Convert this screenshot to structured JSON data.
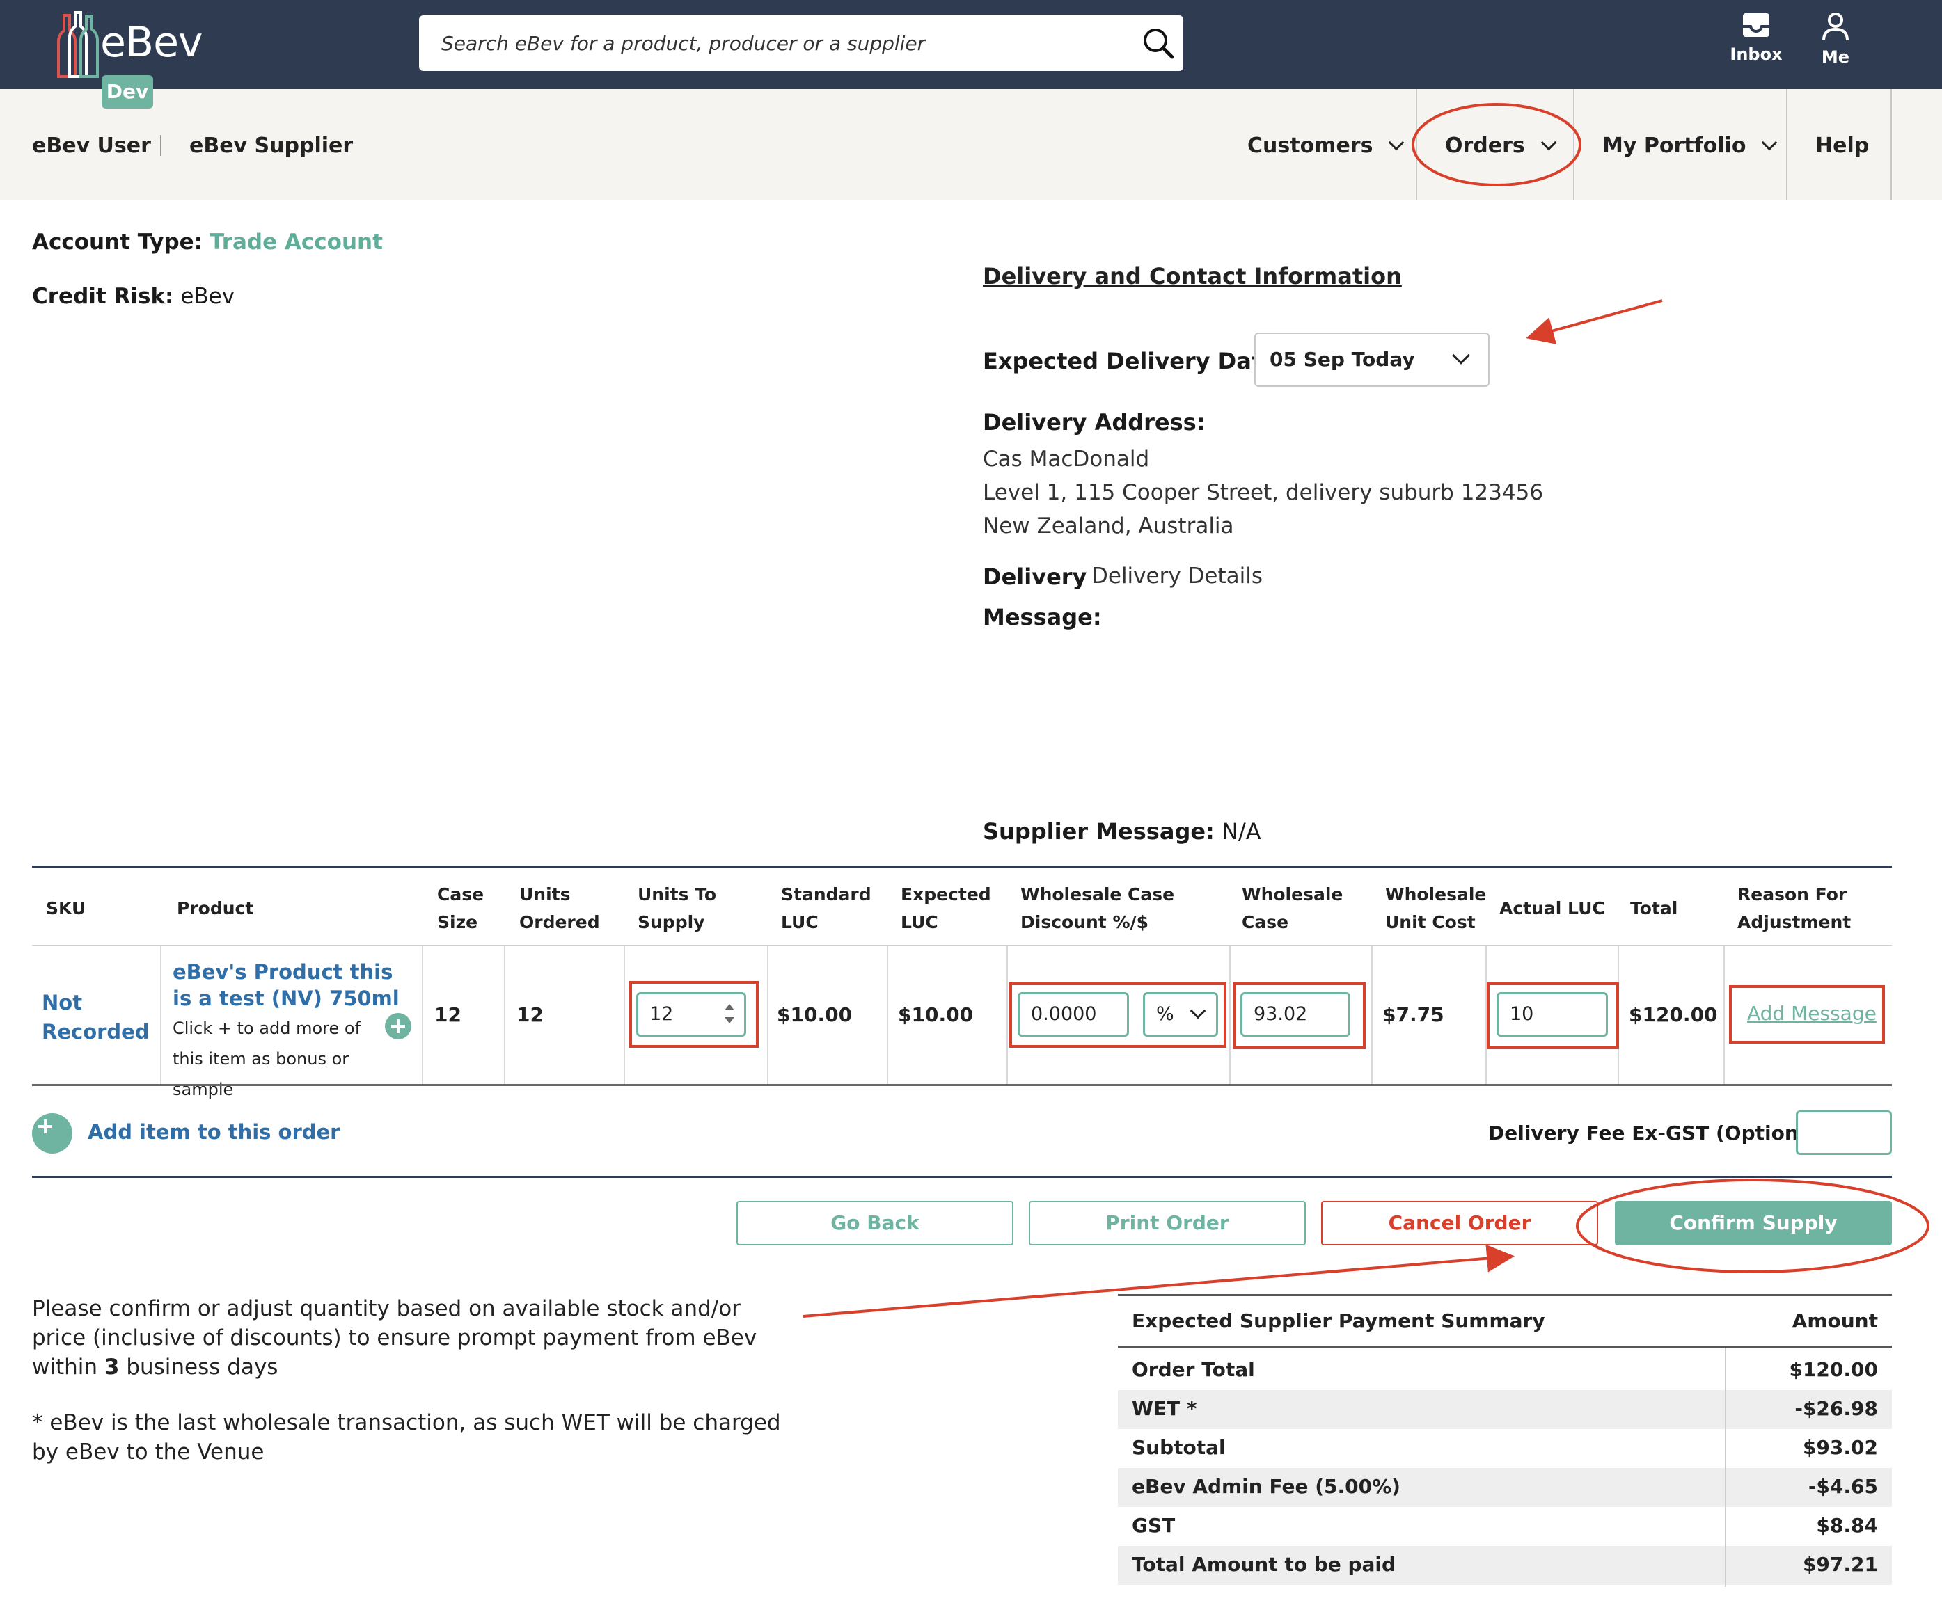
{
  "header": {
    "brand": "eBev",
    "env_badge": "Dev",
    "search_placeholder": "Search eBev for a product, producer or a supplier",
    "inbox_label": "Inbox",
    "me_label": "Me"
  },
  "nav": {
    "user": "eBev User",
    "supplier": "eBev Supplier",
    "items": [
      {
        "label": "Customers"
      },
      {
        "label": "Orders"
      },
      {
        "label": "My Portfolio"
      },
      {
        "label": "Help"
      }
    ]
  },
  "account": {
    "type_label": "Account Type:",
    "type_value": "Trade Account",
    "risk_label": "Credit Risk:",
    "risk_value": "eBev"
  },
  "delivery": {
    "section_title": "Delivery and Contact Information",
    "expected_date_label": "Expected Delivery Date:",
    "expected_date_value": "05 Sep Today",
    "address_label": "Delivery Address:",
    "address_lines": [
      "Cas MacDonald",
      "Level 1, 115 Cooper Street, delivery suburb 123456",
      "New Zealand, Australia"
    ],
    "message_label_1": "Delivery",
    "message_label_2": "Message:",
    "message_value": "Delivery Details",
    "supplier_message_label": "Supplier Message:",
    "supplier_message_value": "N/A"
  },
  "table": {
    "headers": [
      "SKU",
      "Product",
      "Case Size",
      "Units Ordered",
      "Units To Supply",
      "Standard LUC",
      "Expected LUC",
      "Wholesale Case Discount %/$",
      "Wholesale Case",
      "Wholesale Unit Cost",
      "Actual LUC",
      "Total",
      "Reason For Adjustment"
    ],
    "headers_lines": [
      [
        "SKU"
      ],
      [
        "Product"
      ],
      [
        "Case",
        "Size"
      ],
      [
        "Units",
        "Ordered"
      ],
      [
        "Units To",
        "Supply"
      ],
      [
        "Standard",
        "LUC"
      ],
      [
        "Expected",
        "LUC"
      ],
      [
        "Wholesale Case",
        "Discount %/$"
      ],
      [
        "Wholesale",
        "Case"
      ],
      [
        "Wholesale",
        "Unit Cost"
      ],
      [
        "Actual LUC"
      ],
      [
        "Total"
      ],
      [
        "Reason For",
        "Adjustment"
      ]
    ],
    "row": {
      "sku": "Not Recorded",
      "product_name": "eBev's Product this is a test (NV) 750ml",
      "product_hint": "Click + to add more of this item as bonus or sample",
      "case_size": "12",
      "units_ordered": "12",
      "units_to_supply": "12",
      "standard_luc": "$10.00",
      "expected_luc": "$10.00",
      "discount_value": "0.0000",
      "discount_type": "%",
      "wholesale_case": "93.02",
      "wholesale_unit_cost": "$7.75",
      "actual_luc": "10",
      "total": "$120.00",
      "reason_link": "Add Message"
    }
  },
  "actions": {
    "add_item": "Add item to this order",
    "delivery_fee_label": "Delivery Fee Ex-GST (Optional)",
    "go_back": "Go Back",
    "print_order": "Print Order",
    "cancel_order": "Cancel Order",
    "confirm_supply": "Confirm Supply"
  },
  "notes": {
    "confirm_prefix": "Please confirm or adjust quantity based on available stock and/or price (inclusive of discounts) to ensure prompt payment from eBev within ",
    "confirm_days": "3",
    "confirm_suffix": " business days",
    "wet_note": "* eBev is the last wholesale transaction, as such WET will be charged by eBev to the Venue"
  },
  "summary": {
    "title": "Expected Supplier Payment Summary",
    "amount_header": "Amount",
    "rows": [
      {
        "label": "Order Total",
        "value": "$120.00"
      },
      {
        "label": "WET *",
        "value": "-$26.98"
      },
      {
        "label": "Subtotal",
        "value": "$93.02"
      },
      {
        "label": "eBev Admin Fee (5.00%)",
        "value": "-$4.65"
      },
      {
        "label": "GST",
        "value": "$8.84"
      },
      {
        "label": "Total Amount to be paid",
        "value": "$97.21"
      }
    ]
  },
  "colors": {
    "topbar": "#2e3b50",
    "accent": "#6fb3a1",
    "link": "#2f6ea7",
    "annotation": "#d9402b"
  }
}
